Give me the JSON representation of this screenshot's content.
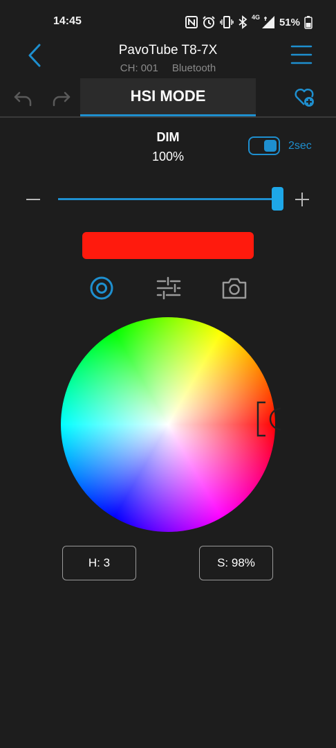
{
  "status_bar": {
    "time": "14:45",
    "network_label": "4G",
    "battery_text": "51%",
    "icons": [
      "nfc-icon",
      "alarm-icon",
      "vibrate-icon",
      "bluetooth-icon",
      "signal-icon",
      "battery-icon"
    ]
  },
  "header": {
    "device_name": "PavoTube T8-7X",
    "channel": "CH: 001",
    "connection": "Bluetooth",
    "back_icon": "chevron-left-icon",
    "menu_icon": "hamburger-menu-icon"
  },
  "tabs": {
    "mode_label": "HSI MODE",
    "undo_icon": "undo-icon",
    "redo_icon": "redo-icon",
    "favorite_icon": "heart-plus-icon"
  },
  "dim": {
    "label": "DIM",
    "value_text": "100%",
    "level": 1.0,
    "fade_enabled": true,
    "fade_label": "2sec"
  },
  "preview": {
    "color": "#ff1a0d"
  },
  "mode_icons": [
    "color-wheel-icon",
    "sliders-icon",
    "camera-icon"
  ],
  "wheel": {
    "hue_deg": 3,
    "saturation_pct": 98
  },
  "values": {
    "hue_text": "H: 3",
    "saturation_text": "S: 98%"
  },
  "colors": {
    "accent": "#1e8fcf",
    "background": "#1d1d1d",
    "tab_background": "#2b2b2b"
  }
}
